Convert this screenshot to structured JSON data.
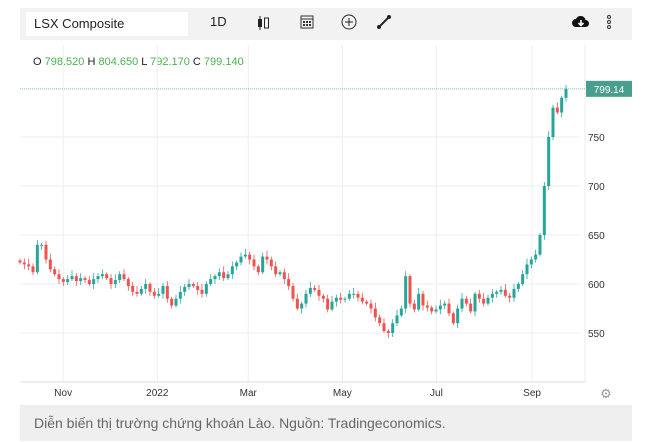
{
  "toolbar": {
    "symbol": "LSX Composite",
    "interval": "1D",
    "icons": [
      "candlestick-icon",
      "calendar-icon",
      "add-circle-icon",
      "draw-line-icon",
      "cloud-download-icon",
      "more-vertical-icon"
    ]
  },
  "ohlc": {
    "o_label": "O",
    "o": "798.520",
    "h_label": "H",
    "h": "804.650",
    "l_label": "L",
    "l": "792.170",
    "c_label": "C",
    "c": "799.140"
  },
  "last_price": "799.14",
  "colors": {
    "up": "#26a69a",
    "down": "#ef5350",
    "price_tag": "#4a9e8e"
  },
  "caption": "Diễn biến thị trường chứng khoán Lào. Nguồn: Tradingeconomics.",
  "chart_data": {
    "type": "candlestick",
    "title": "LSX Composite",
    "x_ticks": [
      "Nov",
      "2022",
      "Mar",
      "May",
      "Jul",
      "Sep"
    ],
    "y_ticks": [
      "550",
      "600",
      "650",
      "700",
      "750"
    ],
    "ylim": [
      505,
      815
    ],
    "x_range": [
      "2021-10-04",
      "2022-09-23"
    ],
    "closes": [
      622,
      620,
      618,
      612,
      640,
      640,
      625,
      615,
      610,
      605,
      602,
      605,
      608,
      603,
      606,
      604,
      600,
      605,
      608,
      610,
      606,
      600,
      604,
      610,
      605,
      598,
      592,
      590,
      595,
      600,
      592,
      588,
      590,
      598,
      585,
      578,
      585,
      592,
      597,
      600,
      598,
      594,
      590,
      600,
      605,
      608,
      612,
      606,
      610,
      618,
      622,
      628,
      630,
      625,
      618,
      612,
      628,
      625,
      618,
      610,
      612,
      605,
      598,
      585,
      575,
      580,
      590,
      596,
      594,
      588,
      585,
      574,
      582,
      586,
      584,
      585,
      590,
      590,
      586,
      582,
      580,
      575,
      566,
      560,
      552,
      550,
      560,
      568,
      575,
      608,
      580,
      574,
      590,
      578,
      576,
      572,
      574,
      578,
      580,
      570,
      560,
      575,
      585,
      580,
      572,
      590,
      585,
      580,
      586,
      590,
      592,
      594,
      588,
      586,
      595,
      600,
      610,
      620,
      625,
      630,
      650,
      700,
      750,
      780,
      775,
      790,
      799.14
    ]
  }
}
